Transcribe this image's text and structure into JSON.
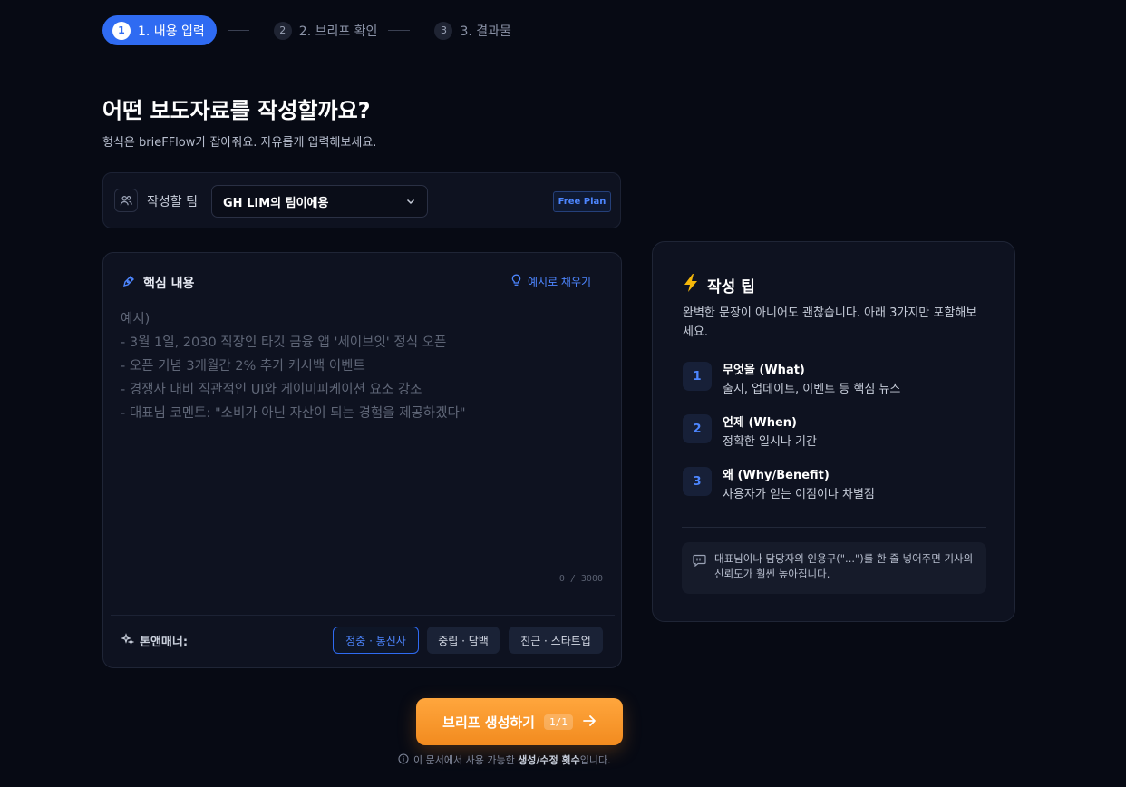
{
  "stepper": {
    "steps": [
      {
        "num": "1",
        "label": "1. 내용 입력"
      },
      {
        "num": "2",
        "label": "2. 브리프 확인"
      },
      {
        "num": "3",
        "label": "3. 결과물"
      }
    ]
  },
  "header": {
    "title": "어떤 보도자료를 작성할까요?",
    "subtitle": "형식은 brieFFlow가 잡아줘요. 자유롭게 입력해보세요."
  },
  "team": {
    "label": "작성할 팀",
    "selected": "GH LIM의 팀이에용",
    "plan_badge": "Free Plan"
  },
  "editor": {
    "title": "핵심 내용",
    "example_link": "예시로 채우기",
    "value": "",
    "placeholder": "예시)\n- 3월 1일, 2030 직장인 타깃 금융 앱 '세이브잇' 정식 오픈\n- 오픈 기념 3개월간 2% 추가 캐시백 이벤트\n- 경쟁사 대비 직관적인 UI와 게이미피케이션 요소 강조\n- 대표님 코멘트: \"소비가 아닌 자산이 되는 경험을 제공하겠다\"",
    "counter": "0 / 3000",
    "tone_label": "톤앤매너:",
    "tones": [
      "정중 · 통신사",
      "중립 · 담백",
      "친근 · 스타트업"
    ],
    "selected_tone_index": 0
  },
  "tips": {
    "title": "작성 팁",
    "description": "완벽한 문장이 아니어도 괜찮습니다. 아래 3가지만 포함해보세요.",
    "items": [
      {
        "num": "1",
        "head": "무엇을 (What)",
        "body": "출시, 업데이트, 이벤트 등 핵심 뉴스"
      },
      {
        "num": "2",
        "head": "언제 (When)",
        "body": "정확한 일시나 기간"
      },
      {
        "num": "3",
        "head": "왜 (Why/Benefit)",
        "body": "사용자가 얻는 이점이나 차별점"
      }
    ],
    "quote_tip": "대표님이나 담당자의 인용구(\"...\")를 한 줄 넣어주면 기사의 신뢰도가 훨씬 높아집니다."
  },
  "cta": {
    "label": "브리프 생성하기",
    "count": "1/1"
  },
  "footnote": {
    "prefix": "이 문서에서 사용 가능한 ",
    "bold": "생성/수정 횟수",
    "suffix": "입니다."
  },
  "colors": {
    "background": "#070a14",
    "accent_blue": "#2f6bf2",
    "accent_orange": "#ffa63d",
    "tip_bolt": "#f5b70a"
  },
  "icons": [
    "team-icon",
    "chevron-down-icon",
    "pen-icon",
    "lightbulb-icon",
    "sparkles-icon",
    "bolt-icon",
    "quote-icon",
    "arrow-right-icon",
    "info-icon"
  ]
}
